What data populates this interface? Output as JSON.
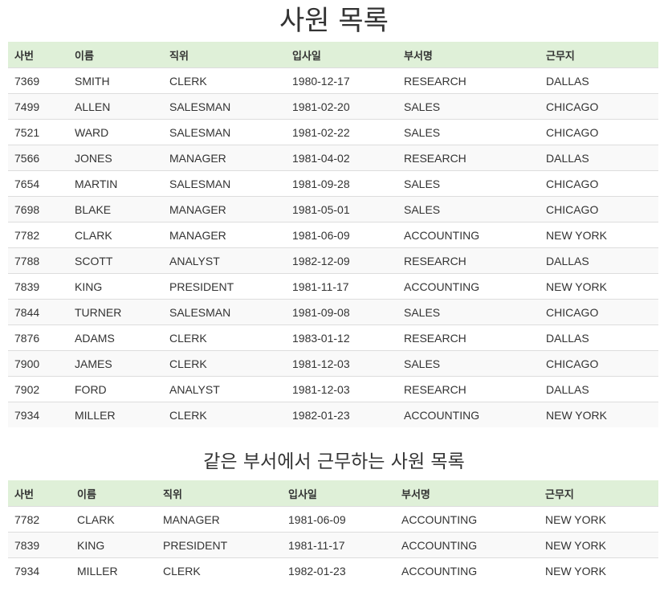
{
  "page": {
    "title": "사원 목록"
  },
  "employees": {
    "columns": [
      "사번",
      "이름",
      "직위",
      "입사일",
      "부서명",
      "근무지"
    ],
    "rows": [
      [
        "7369",
        "SMITH",
        "CLERK",
        "1980-12-17",
        "RESEARCH",
        "DALLAS"
      ],
      [
        "7499",
        "ALLEN",
        "SALESMAN",
        "1981-02-20",
        "SALES",
        "CHICAGO"
      ],
      [
        "7521",
        "WARD",
        "SALESMAN",
        "1981-02-22",
        "SALES",
        "CHICAGO"
      ],
      [
        "7566",
        "JONES",
        "MANAGER",
        "1981-04-02",
        "RESEARCH",
        "DALLAS"
      ],
      [
        "7654",
        "MARTIN",
        "SALESMAN",
        "1981-09-28",
        "SALES",
        "CHICAGO"
      ],
      [
        "7698",
        "BLAKE",
        "MANAGER",
        "1981-05-01",
        "SALES",
        "CHICAGO"
      ],
      [
        "7782",
        "CLARK",
        "MANAGER",
        "1981-06-09",
        "ACCOUNTING",
        "NEW YORK"
      ],
      [
        "7788",
        "SCOTT",
        "ANALYST",
        "1982-12-09",
        "RESEARCH",
        "DALLAS"
      ],
      [
        "7839",
        "KING",
        "PRESIDENT",
        "1981-11-17",
        "ACCOUNTING",
        "NEW YORK"
      ],
      [
        "7844",
        "TURNER",
        "SALESMAN",
        "1981-09-08",
        "SALES",
        "CHICAGO"
      ],
      [
        "7876",
        "ADAMS",
        "CLERK",
        "1983-01-12",
        "RESEARCH",
        "DALLAS"
      ],
      [
        "7900",
        "JAMES",
        "CLERK",
        "1981-12-03",
        "SALES",
        "CHICAGO"
      ],
      [
        "7902",
        "FORD",
        "ANALYST",
        "1981-12-03",
        "RESEARCH",
        "DALLAS"
      ],
      [
        "7934",
        "MILLER",
        "CLERK",
        "1982-01-23",
        "ACCOUNTING",
        "NEW YORK"
      ]
    ]
  },
  "same_dept": {
    "title": "같은 부서에서 근무하는 사원 목록",
    "columns": [
      "사번",
      "이름",
      "직위",
      "입사일",
      "부서명",
      "근무지"
    ],
    "rows": [
      [
        "7782",
        "CLARK",
        "MANAGER",
        "1981-06-09",
        "ACCOUNTING",
        "NEW YORK"
      ],
      [
        "7839",
        "KING",
        "PRESIDENT",
        "1981-11-17",
        "ACCOUNTING",
        "NEW YORK"
      ],
      [
        "7934",
        "MILLER",
        "CLERK",
        "1982-01-23",
        "ACCOUNTING",
        "NEW YORK"
      ]
    ]
  },
  "colors": {
    "header_bg": "#dff0d8",
    "row_alt_bg": "#f9f9f9",
    "border": "#dddddd",
    "text": "#333333"
  }
}
